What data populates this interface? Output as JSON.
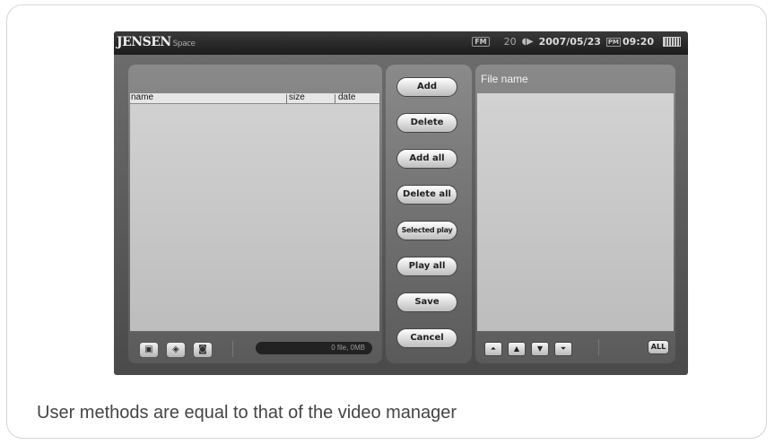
{
  "device": {
    "logo": "JENSEN",
    "logo_sub": "Space",
    "status": {
      "fm_badge": "FM",
      "volume": "20",
      "date": "2007/05/23",
      "ampm": "PM",
      "time": "09:20",
      "speaker_icon": "speaker-icon",
      "battery_icon": "battery-icon"
    }
  },
  "left_panel": {
    "columns": [
      "name",
      "size",
      "date"
    ],
    "footer_icons": [
      "folder-icon",
      "disc-icon",
      "camera-icon"
    ],
    "file_status": "0 file,  0MB"
  },
  "middle_panel": {
    "buttons": [
      "Add",
      "Delete",
      "Add all",
      "Delete all",
      "Selected play",
      "Play all",
      "Save",
      "Cancel"
    ]
  },
  "right_panel": {
    "title": "File name",
    "nav_icons": [
      "top-icon",
      "up-icon",
      "down-icon",
      "bottom-icon"
    ],
    "all_label": "ALL"
  },
  "caption": "User methods are equal to that of the video manager",
  "colors": {
    "panel": "#6e6e6e",
    "list_bg": "#c8c8c8",
    "topbar": "#1c1c1c"
  }
}
